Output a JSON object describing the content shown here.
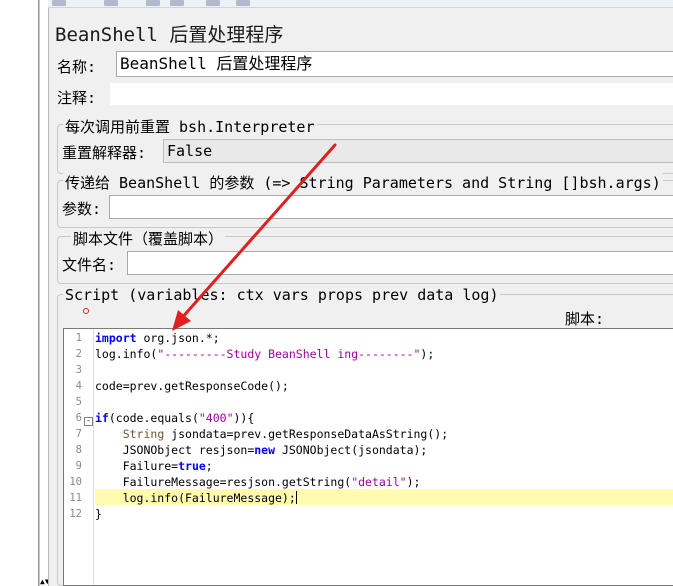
{
  "panel_title": "BeanShell 后置处理程序",
  "name": {
    "label": "名称:",
    "value": "BeanShell 后置处理程序"
  },
  "comment": {
    "label": "注释:",
    "value": ""
  },
  "reset_group": {
    "title": "每次调用前重置 bsh.Interpreter",
    "label": "重置解释器:",
    "value": "False"
  },
  "params_group": {
    "title": "传递给 BeanShell 的参数 (=> String Parameters and String []bsh.args)",
    "label": "参数:",
    "value": ""
  },
  "file_group": {
    "title": "脚本文件（覆盖脚本）",
    "label": "文件名:",
    "value": ""
  },
  "script_group": {
    "title": "Script (variables: ctx vars props prev data log)",
    "script_label": "脚本:"
  },
  "code": {
    "line_numbers": [
      "1",
      "2",
      "3",
      "4",
      "5",
      "6",
      "7",
      "8",
      "9",
      "10",
      "11",
      "12"
    ],
    "lines": [
      "import org.json.*;",
      "log.info(\"---------Study BeanShell ing--------\");",
      "",
      "code=prev.getResponseCode();",
      "",
      "if(code.equals(\"400\")){",
      "    String jsondata=prev.getResponseDataAsString();",
      "    JSONObject resjson=new JSONObject(jsondata);",
      "    Failure=true;",
      "    FailureMessage=resjson.getString(\"detail\");",
      "    log.info(FailureMessage);",
      "}"
    ],
    "highlighted_line": 11,
    "fold_marker": "-"
  },
  "colors": {
    "keyword": "#0000ff",
    "string": "#a000a0",
    "highlight": "#fffaae",
    "annotation": "#e02020"
  },
  "icons": [
    "fold-minus-icon",
    "red-annotation-arrow-icon",
    "scroll-down-icon"
  ]
}
